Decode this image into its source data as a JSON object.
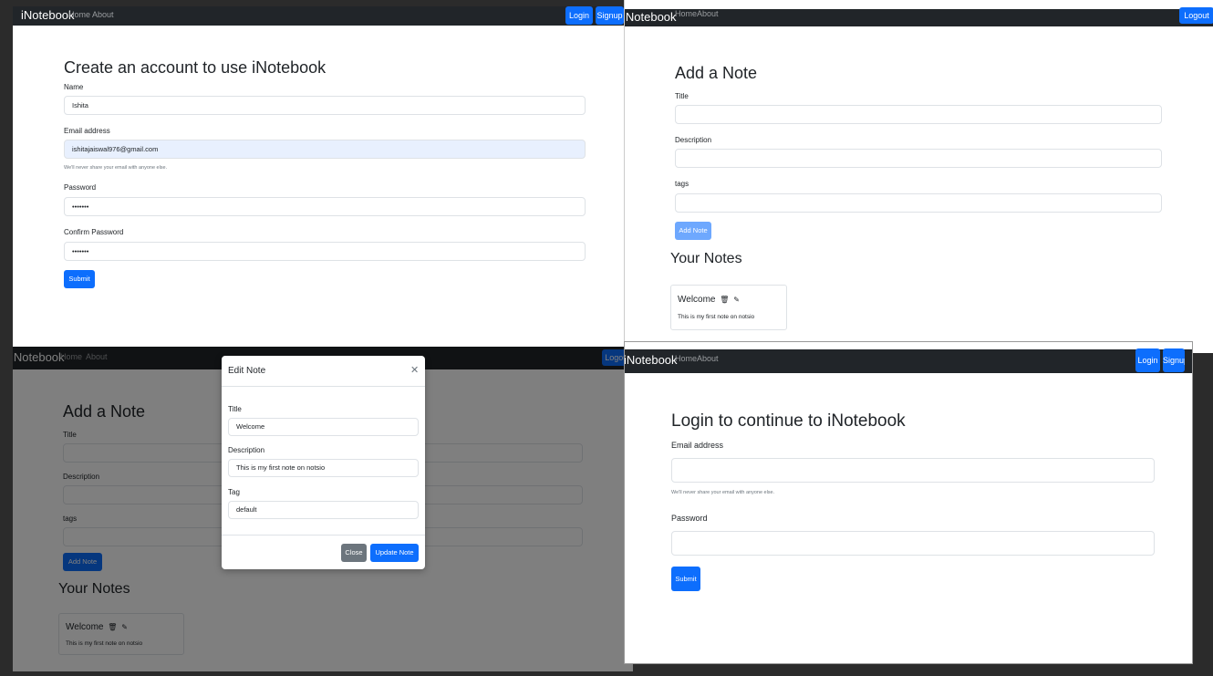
{
  "signup": {
    "brand": "iNotebook",
    "nav_home": "Home",
    "nav_about": "About",
    "login_label": "Login",
    "signup_label": "Signup",
    "heading": "Create an account to use iNotebook",
    "name_label": "Name",
    "name_value": "Ishita",
    "email_label": "Email address",
    "email_value": "ishitajaiswal976@gmail.com",
    "email_help": "We'll never share your email with anyone else.",
    "password_label": "Password",
    "password_value": "•••••••",
    "confirm_label": "Confirm Password",
    "confirm_value": "•••••••",
    "submit_label": "Submit"
  },
  "addnote": {
    "brand": "iNotebook",
    "nav_home": "Home",
    "nav_about": "About",
    "logout_label": "Logout",
    "heading": "Add a Note",
    "title_label": "Title",
    "description_label": "Description",
    "tags_label": "tags",
    "add_label": "Add Note",
    "notes_heading": "Your Notes",
    "note_title": "Welcome",
    "note_description": "This is my first note on notsio"
  },
  "editnote": {
    "brand": "iNotebook",
    "nav_home": "Home",
    "nav_about": "About",
    "logout_label": "Logout",
    "heading": "Add a Note",
    "title_label": "Title",
    "description_label": "Description",
    "tags_label": "tags",
    "add_label": "Add Note",
    "notes_heading": "Your Notes",
    "note_title": "Welcome",
    "note_description": "This is my first note on notsio",
    "modal": {
      "title": "Edit Note",
      "close_glyph": "✕",
      "title_label": "Title",
      "title_value": "Welcome",
      "description_label": "Description",
      "description_value": "This is my first note on notsio",
      "tag_label": "Tag",
      "tag_value": "default",
      "close_label": "Close",
      "update_label": "Update Note"
    }
  },
  "login": {
    "brand": "iNotebook",
    "nav_home": "Home",
    "nav_about": "About",
    "login_label": "Login",
    "signup_label": "Signup",
    "heading": "Login to continue to iNotebook",
    "email_label": "Email address",
    "email_help": "We'll never share your email with anyone else.",
    "password_label": "Password",
    "submit_label": "Submit"
  },
  "colors": {
    "navbar": "#212529",
    "primary": "#0d6efd",
    "secondary": "#6c757d",
    "autofill": "#e8f0fe"
  },
  "icons": {
    "delete": "trash-icon",
    "edit": "edit-icon"
  }
}
